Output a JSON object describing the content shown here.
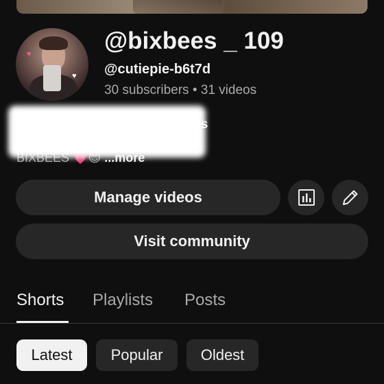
{
  "channel": {
    "name": "@bixbees _ 109",
    "handle": "@cutiepie-b6t7d",
    "stats": "30 subscribers • 31 videos",
    "description_partial": "cribers",
    "description_line2": "BIXBEES 💗😊",
    "more_label": " ...more"
  },
  "actions": {
    "manage_videos": "Manage videos",
    "visit_community": "Visit community",
    "analytics_icon": "bar-chart-icon",
    "edit_icon": "pencil-icon"
  },
  "tabs": [
    {
      "label": "Shorts",
      "active": true
    },
    {
      "label": "Playlists",
      "active": false
    },
    {
      "label": "Posts",
      "active": false
    }
  ],
  "sort_chips": [
    {
      "label": "Latest",
      "selected": true
    },
    {
      "label": "Popular",
      "selected": false
    },
    {
      "label": "Oldest",
      "selected": false
    }
  ],
  "colors": {
    "background": "#0f0f0f",
    "surface": "#272727",
    "text_primary": "#f1f1f1",
    "text_secondary": "#aaaaaa"
  }
}
